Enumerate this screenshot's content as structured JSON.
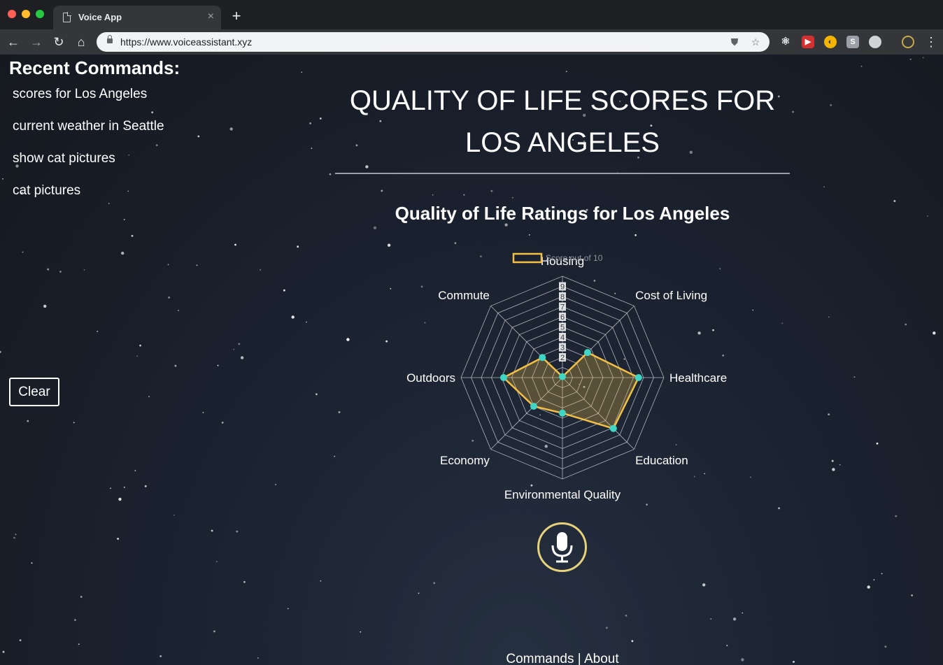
{
  "browser": {
    "tab_title": "Voice App",
    "url": "https://www.voiceassistant.xyz"
  },
  "sidebar": {
    "title": "Recent Commands:",
    "commands": [
      "scores for Los Angeles",
      "current weather in Seattle",
      "show cat pictures",
      "cat pictures"
    ],
    "clear_label": "Clear"
  },
  "main": {
    "title": "QUALITY OF LIFE SCORES FOR LOS ANGELES"
  },
  "chart_data": {
    "type": "radar",
    "title": "Quality of Life Ratings for Los Angeles",
    "legend": {
      "label": "Score out of 10",
      "position": "top"
    },
    "categories": [
      "Housing",
      "Cost of Living",
      "Healthcare",
      "Education",
      "Environmental Quality",
      "Economy",
      "Outdoors",
      "Commute"
    ],
    "series": [
      {
        "name": "Score out of 10",
        "values": [
          0.1,
          3.5,
          7.5,
          7.1,
          3.5,
          4.0,
          5.8,
          2.8
        ]
      }
    ],
    "scale": {
      "min": 0,
      "max": 10,
      "ticks": [
        2,
        3,
        4,
        5,
        6,
        7,
        8,
        9
      ]
    },
    "colors": {
      "line": "#f3c044",
      "fill": "rgba(243,192,68,0.28)",
      "point": "#3fd6c5",
      "grid": "#c9ccd2"
    }
  },
  "footer": {
    "commands_label": "Commands",
    "separator": "|",
    "about_label": "About"
  }
}
